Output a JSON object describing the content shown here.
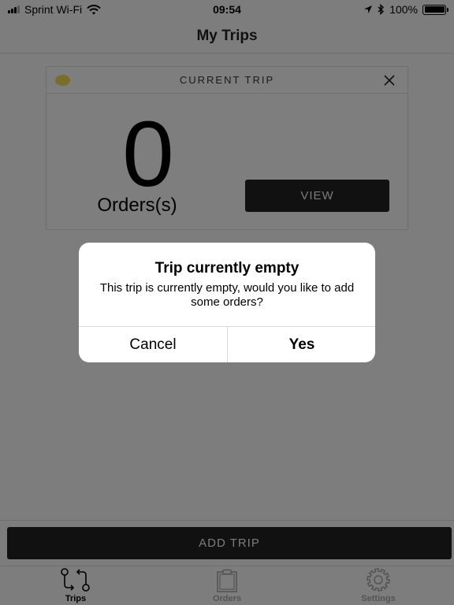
{
  "status_bar": {
    "carrier": "Sprint Wi-Fi",
    "time": "09:54",
    "battery": "100%",
    "battery_level": 1.0
  },
  "nav": {
    "title": "My Trips"
  },
  "trip_card": {
    "title": "CURRENT TRIP",
    "count": "0",
    "count_label": "Orders(s)",
    "view_label": "VIEW",
    "status_color": "#7a6e2b"
  },
  "alert": {
    "title": "Trip currently empty",
    "message": "This trip is currently empty, would you like to add some orders?",
    "cancel_label": "Cancel",
    "yes_label": "Yes"
  },
  "add_trip": {
    "label": "ADD TRIP"
  },
  "tabs": [
    {
      "label": "Trips",
      "icon": "trips-icon",
      "active": true
    },
    {
      "label": "Orders",
      "icon": "clipboard-icon",
      "active": false
    },
    {
      "label": "Settings",
      "icon": "gear-icon",
      "active": false
    }
  ],
  "colors": {
    "dim_background": "#7d7d7d",
    "button_dark": "#111111",
    "alert_background": "#ffffff"
  }
}
